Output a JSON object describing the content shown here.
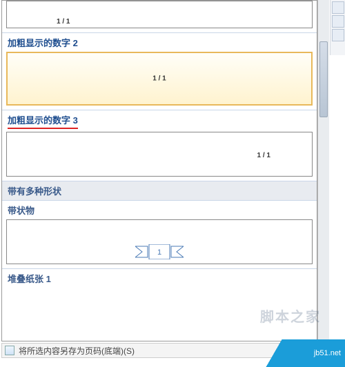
{
  "preview1_page": "1 / 1",
  "hdr_bold2": "加粗显示的数字 2",
  "preview2_page": "1 / 1",
  "hdr_bold3": "加粗显示的数字 3",
  "preview3_page": "1 / 1",
  "hdr_shapes": "带有多种形状",
  "hdr_strip": "带状物",
  "ribbon_num": "1",
  "hdr_stack": "堆叠纸张 1",
  "save_label": "将所选内容另存为页码(底端)(S)",
  "watermark_cn": "脚本之家",
  "watermark_foot": "jb51.net"
}
